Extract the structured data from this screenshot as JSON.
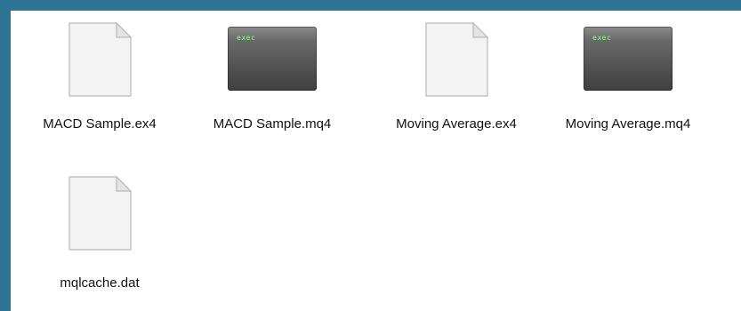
{
  "files": [
    {
      "name": "MACD Sample.ex4",
      "type": "document"
    },
    {
      "name": "MACD Sample.mq4",
      "type": "exec",
      "badge": "exec"
    },
    {
      "name": "Moving Average.ex4",
      "type": "document"
    },
    {
      "name": "Moving Average.mq4",
      "type": "exec",
      "badge": "exec"
    },
    {
      "name": "mqlcache.dat",
      "type": "document"
    }
  ],
  "colors": {
    "desktop_background": "#2f7397",
    "window_background": "#ffffff",
    "exec_badge_text": "#8dff8d"
  }
}
